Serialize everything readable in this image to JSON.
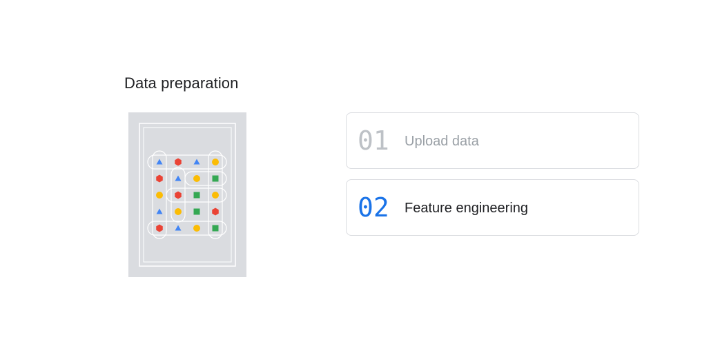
{
  "title": "Data preparation",
  "steps": [
    {
      "number": "01",
      "label": "Upload data",
      "number_color": "#bdc1c6",
      "label_color": "#9aa0a6"
    },
    {
      "number": "02",
      "label": "Feature engineering",
      "number_color": "#1a73e8",
      "label_color": "#202124"
    }
  ],
  "illustration": {
    "colors": {
      "red": "#ea4335",
      "blue": "#4285f4",
      "yellow": "#fbbc04",
      "green": "#34a853",
      "background": "#dadce0",
      "outline": "#ffffff"
    },
    "grid": [
      [
        "blue-triangle-icon",
        "red-hexagon-icon",
        "blue-triangle-icon",
        "yellow-circle-icon"
      ],
      [
        "red-hexagon-icon",
        "blue-triangle-icon",
        "yellow-circle-icon",
        "green-square-icon"
      ],
      [
        "yellow-circle-icon",
        "red-hexagon-icon",
        "green-square-icon",
        "yellow-circle-icon"
      ],
      [
        "blue-triangle-icon",
        "yellow-circle-icon",
        "green-square-icon",
        "red-hexagon-icon"
      ],
      [
        "red-hexagon-icon",
        "blue-triangle-icon",
        "yellow-circle-icon",
        "green-square-icon"
      ]
    ]
  }
}
